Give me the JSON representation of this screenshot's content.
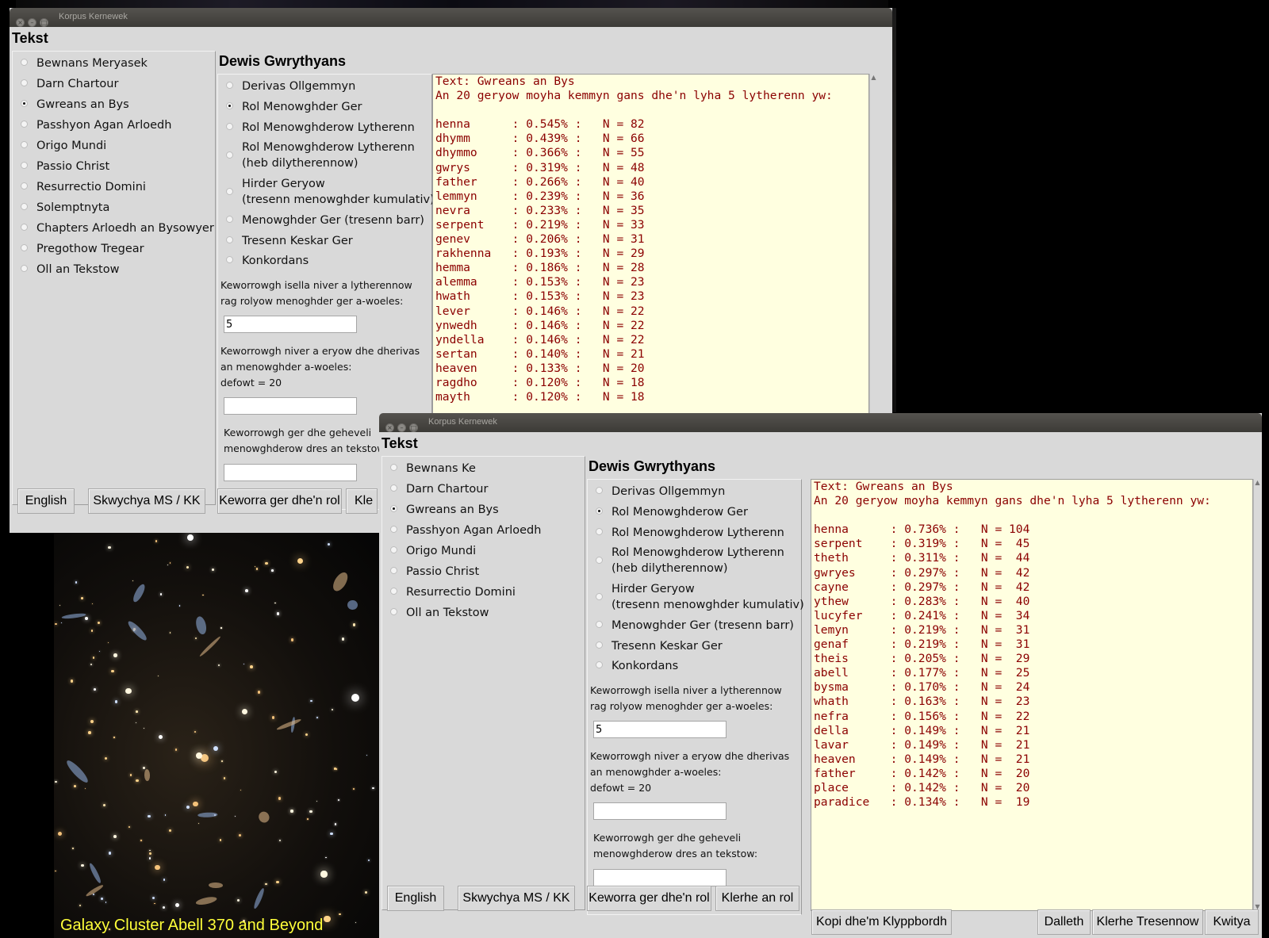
{
  "background": {
    "caption": "Galaxy Cluster Abell 370 and Beyond"
  },
  "window1": {
    "title": "Korpus Kernewek",
    "tekst_heading": "Tekst",
    "dewis_heading": "Dewis Gwrythyans",
    "texts": [
      {
        "label": "Bewnans Meryasek",
        "selected": false
      },
      {
        "label": "Darn Chartour",
        "selected": false
      },
      {
        "label": "Gwreans an Bys",
        "selected": true
      },
      {
        "label": "Passhyon Agan Arloedh",
        "selected": false
      },
      {
        "label": "Origo Mundi",
        "selected": false
      },
      {
        "label": "Passio Christ",
        "selected": false
      },
      {
        "label": "Resurrectio Domini",
        "selected": false
      },
      {
        "label": "Solemptnyta",
        "selected": false
      },
      {
        "label": "Chapters Arloedh an Bysowyer",
        "selected": false
      },
      {
        "label": "Pregothow Tregear",
        "selected": false
      },
      {
        "label": "Oll an Tekstow",
        "selected": false
      }
    ],
    "functions": [
      {
        "label": "Derivas Ollgemmyn",
        "label2": "",
        "selected": false
      },
      {
        "label": "Rol Menowghder Ger",
        "label2": "",
        "selected": true
      },
      {
        "label": "Rol Menowghderow Lytherenn",
        "label2": "",
        "selected": false
      },
      {
        "label": "Rol Menowghderow Lytherenn",
        "label2": "(heb dilytherennow)",
        "selected": false
      },
      {
        "label": "Hirder Geryow",
        "label2": "(tresenn menowghder kumulativ)",
        "selected": false
      },
      {
        "label": "Menowghder Ger (tresenn barr)",
        "label2": "",
        "selected": false
      },
      {
        "label": "Tresenn Keskar Ger",
        "label2": "",
        "selected": false
      },
      {
        "label": "Konkordans",
        "label2": "",
        "selected": false
      }
    ],
    "prompt_min_1": "Keworrowgh isella niver a lytherennow",
    "prompt_min_2": "rag rolyow menoghder ger a-woeles:",
    "min_value": "5",
    "prompt_n_1": "Keworrowgh niver a eryow dhe dherivas",
    "prompt_n_2": "an menowghder a-woeles:",
    "prompt_n_3": "defowt = 20",
    "n_value": "",
    "prompt_cmp_1": "Keworrowgh ger dhe geheveli",
    "prompt_cmp_2": "menowghderow dres an tekstow:",
    "cmp_value": "",
    "output_header_1": "Text: Gwreans an Bys",
    "output_header_2": "An 20 geryow moyha kemmyn gans dhe'n lyha 5 lytherenn yw:",
    "output_rows": [
      [
        "henna",
        "0.545%",
        "82"
      ],
      [
        "dhymm",
        "0.439%",
        "66"
      ],
      [
        "dhymmo",
        "0.366%",
        "55"
      ],
      [
        "gwrys",
        "0.319%",
        "48"
      ],
      [
        "father",
        "0.266%",
        "40"
      ],
      [
        "lemmyn",
        "0.239%",
        "36"
      ],
      [
        "nevra",
        "0.233%",
        "35"
      ],
      [
        "serpent",
        "0.219%",
        "33"
      ],
      [
        "genev",
        "0.206%",
        "31"
      ],
      [
        "rakhenna",
        "0.193%",
        "29"
      ],
      [
        "hemma",
        "0.186%",
        "28"
      ],
      [
        "alemma",
        "0.153%",
        "23"
      ],
      [
        "hwath",
        "0.153%",
        "23"
      ],
      [
        "lever",
        "0.146%",
        "22"
      ],
      [
        "ynwedh",
        "0.146%",
        "22"
      ],
      [
        "yndella",
        "0.146%",
        "22"
      ],
      [
        "sertan",
        "0.140%",
        "21"
      ],
      [
        "heaven",
        "0.133%",
        "20"
      ],
      [
        "ragdho",
        "0.120%",
        "18"
      ],
      [
        "mayth",
        "0.120%",
        "18"
      ]
    ],
    "btn_english": "English",
    "btn_skwychya": "Skwychya MS / KK",
    "btn_keworra": "Keworra ger dhe'n rol",
    "btn_klerhe_partial": "Kle"
  },
  "window2": {
    "title": "Korpus Kernewek",
    "tekst_heading": "Tekst",
    "dewis_heading": "Dewis Gwrythyans",
    "texts": [
      {
        "label": "Bewnans Ke",
        "selected": false
      },
      {
        "label": "Darn Chartour",
        "selected": false
      },
      {
        "label": "Gwreans an Bys",
        "selected": true
      },
      {
        "label": "Passhyon Agan Arloedh",
        "selected": false
      },
      {
        "label": "Origo Mundi",
        "selected": false
      },
      {
        "label": "Passio Christ",
        "selected": false
      },
      {
        "label": "Resurrectio Domini",
        "selected": false
      },
      {
        "label": "Oll an Tekstow",
        "selected": false
      }
    ],
    "functions": [
      {
        "label": "Derivas Ollgemmyn",
        "label2": "",
        "selected": false
      },
      {
        "label": "Rol Menowghderow Ger",
        "label2": "",
        "selected": true
      },
      {
        "label": "Rol Menowghderow Lytherenn",
        "label2": "",
        "selected": false
      },
      {
        "label": "Rol Menowghderow Lytherenn",
        "label2": "(heb dilytherennow)",
        "selected": false
      },
      {
        "label": "Hirder Geryow",
        "label2": "(tresenn menowghder kumulativ)",
        "selected": false
      },
      {
        "label": "Menowghder Ger (tresenn barr)",
        "label2": "",
        "selected": false
      },
      {
        "label": "Tresenn Keskar Ger",
        "label2": "",
        "selected": false
      },
      {
        "label": "Konkordans",
        "label2": "",
        "selected": false
      }
    ],
    "prompt_min_1": "Keworrowgh isella niver a lytherennow",
    "prompt_min_2": "rag rolyow menoghder ger a-woeles:",
    "min_value": "5",
    "prompt_n_1": "Keworrowgh niver a eryow dhe dherivas",
    "prompt_n_2": "an menowghder a-woeles:",
    "prompt_n_3": "defowt = 20",
    "n_value": "",
    "prompt_cmp_1": "Keworrowgh ger dhe geheveli",
    "prompt_cmp_2": "menowghderow dres an tekstow:",
    "cmp_value": "",
    "output_header_1": "Text: Gwreans an Bys",
    "output_header_2": "An 20 geryow moyha kemmyn gans dhe'n lyha 5 lytherenn yw:",
    "output_rows": [
      [
        "henna",
        "0.736%",
        "104"
      ],
      [
        "serpent",
        "0.319%",
        "45"
      ],
      [
        "theth",
        "0.311%",
        "44"
      ],
      [
        "gwryes",
        "0.297%",
        "42"
      ],
      [
        "cayne",
        "0.297%",
        "42"
      ],
      [
        "ythew",
        "0.283%",
        "40"
      ],
      [
        "lucyfer",
        "0.241%",
        "34"
      ],
      [
        "lemyn",
        "0.219%",
        "31"
      ],
      [
        "genaf",
        "0.219%",
        "31"
      ],
      [
        "theis",
        "0.205%",
        "29"
      ],
      [
        "abell",
        "0.177%",
        "25"
      ],
      [
        "bysma",
        "0.170%",
        "24"
      ],
      [
        "whath",
        "0.163%",
        "23"
      ],
      [
        "nefra",
        "0.156%",
        "22"
      ],
      [
        "della",
        "0.149%",
        "21"
      ],
      [
        "lavar",
        "0.149%",
        "21"
      ],
      [
        "heaven",
        "0.149%",
        "21"
      ],
      [
        "father",
        "0.142%",
        "20"
      ],
      [
        "place",
        "0.142%",
        "20"
      ],
      [
        "paradice",
        "0.134%",
        "19"
      ]
    ],
    "btn_english": "English",
    "btn_skwychya": "Skwychya MS / KK",
    "btn_keworra": "Keworra ger dhe'n rol",
    "btn_klerhe_rol": "Klerhe an rol",
    "btn_kopi": "Kopi dhe'm Klyppbordh",
    "btn_dalleth": "Dalleth",
    "btn_klerhe_tresennow": "Klerhe Tresennow",
    "btn_kwitya": "Kwitya"
  }
}
